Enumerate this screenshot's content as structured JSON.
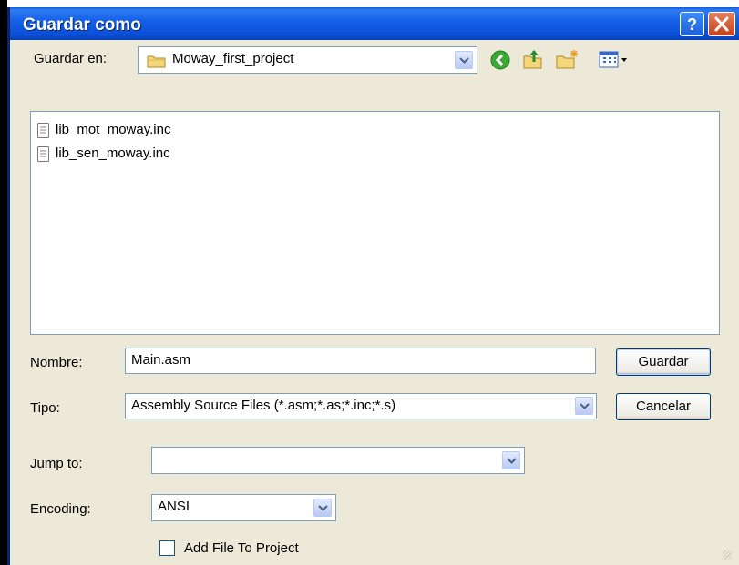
{
  "window": {
    "title": "Guardar como"
  },
  "save_in": {
    "label": "Guardar en:",
    "value": "Moway_first_project"
  },
  "toolbar": {
    "icons": [
      "back-icon",
      "up-folder-icon",
      "new-folder-icon",
      "view-menu-icon"
    ]
  },
  "files": [
    {
      "name": "lib_mot_moway.inc",
      "icon": "text-file-icon"
    },
    {
      "name": "lib_sen_moway.inc",
      "icon": "text-file-icon"
    }
  ],
  "name_field": {
    "label": "Nombre:",
    "value": "Main.asm"
  },
  "type_field": {
    "label": "Tipo:",
    "value": "Assembly Source Files (*.asm;*.as;*.inc;*.s)"
  },
  "buttons": {
    "save": "Guardar",
    "cancel": "Cancelar"
  },
  "jump_to": {
    "label": "Jump to:",
    "value": ""
  },
  "encoding": {
    "label": "Encoding:",
    "value": "ANSI"
  },
  "add_to_project": {
    "label": "Add File To Project",
    "checked": false
  },
  "colors": {
    "titlebar": "#0a4fd6",
    "dialog_bg": "#ece9d8",
    "close_button": "#c3421c"
  }
}
